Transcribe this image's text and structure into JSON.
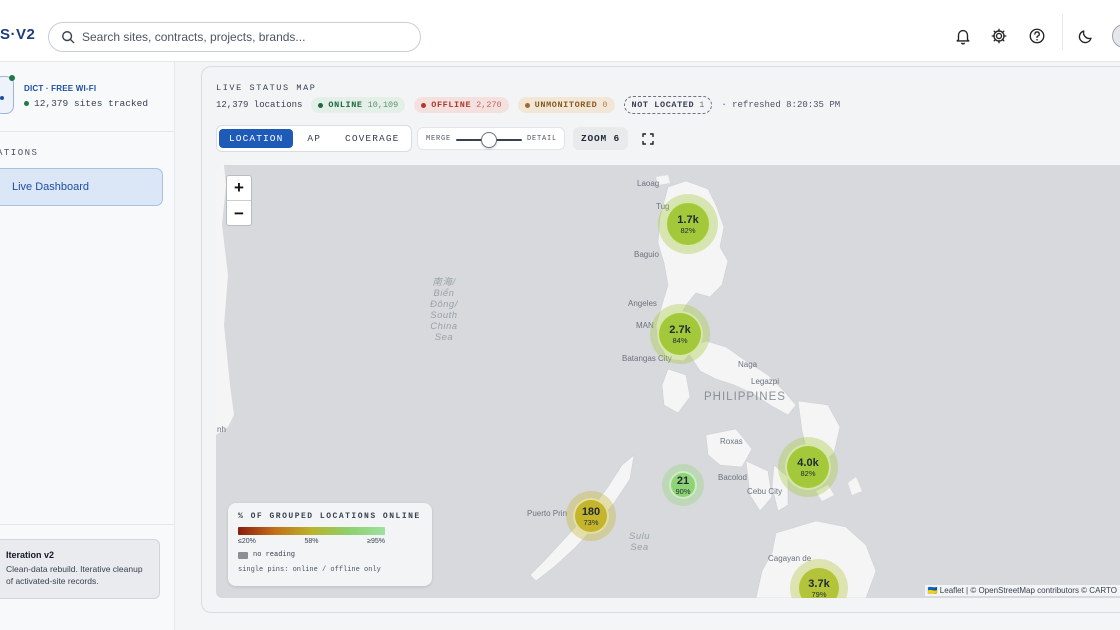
{
  "header": {
    "brand": "S·V2",
    "search_placeholder": "Search sites, contracts, projects, brands..."
  },
  "sidebar": {
    "org_name": "DICT · FREE WI-FI",
    "sites_tracked": "12,379 sites tracked",
    "section_label": "ATIONS",
    "nav_active": "Live Dashboard",
    "iteration": {
      "title": "Iteration v2",
      "description": "Clean-data rebuild. Iterative cleanup of activated-site records."
    }
  },
  "status": {
    "title": "LIVE STATUS MAP",
    "locations": "12,379 locations",
    "online_label": "ONLINE",
    "online_count": "10,109",
    "offline_label": "OFFLINE",
    "offline_count": "2,270",
    "unmonitored_label": "UNMONITORED",
    "unmonitored_count": "0",
    "not_located_label": "NOT LOCATED",
    "not_located_count": "1",
    "refreshed": "· refreshed 8:20:35 PM"
  },
  "controls": {
    "tabs": [
      "LOCATION",
      "AP",
      "COVERAGE"
    ],
    "active_tab": "LOCATION",
    "merge_label": "MERGE",
    "detail_label": "DETAIL",
    "slider_fraction": 0.5,
    "zoom_label": "ZOOM 6"
  },
  "map": {
    "zoom_in": "+",
    "zoom_out": "−",
    "country": "PHILIPPINES",
    "seas": [
      {
        "name": "南海/\nBiển\nĐông/\nSouth\nChina\nSea"
      },
      {
        "name": "Sulu\nSea"
      }
    ],
    "places": [
      "Laoag",
      "Tug",
      "Baguio",
      "Angeles",
      "MAN",
      "Batangas City",
      "Naga",
      "Legazpi",
      "Roxas",
      "Bacolod",
      "Cebu City",
      "Puerto Prin",
      "Cagayan de",
      "nh"
    ],
    "clusters": [
      {
        "count": "1.7k",
        "pct": "82%",
        "color": "#a3c93a"
      },
      {
        "count": "2.7k",
        "pct": "84%",
        "color": "#a3c93a"
      },
      {
        "count": "4.0k",
        "pct": "82%",
        "color": "#a3c93a"
      },
      {
        "count": "21",
        "pct": "90%",
        "color": "#8ed477"
      },
      {
        "count": "180",
        "pct": "73%",
        "color": "#c5b52c"
      },
      {
        "count": "3.7k",
        "pct": "79%",
        "color": "#b4c43a"
      }
    ],
    "attribution": "🇺🇦 Leaflet | © OpenStreetMap contributors © CARTO"
  },
  "legend": {
    "title": "% OF GROUPED LOCATIONS ONLINE",
    "tick_low": "≤20%",
    "tick_mid": "58%",
    "tick_high": "≥95%",
    "no_reading": "no reading",
    "footnote": "single pins: online / offline only"
  }
}
